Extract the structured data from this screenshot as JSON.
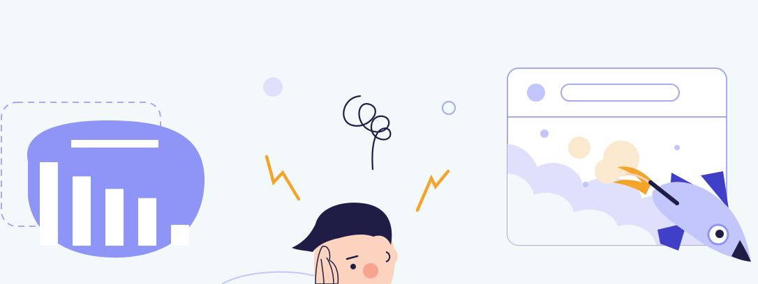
{
  "scene": {
    "background": "#f3f8fb",
    "accent": "#8f94f7",
    "light_accent": "#c3c6fb",
    "lavender": "#dfe0fb",
    "dark": "#1f1d45",
    "orange": "#f3a52b",
    "skin": "#fbd3bf",
    "cheek": "#f7a38e",
    "white": "#ffffff"
  },
  "bar_chart": {
    "bars": [
      1.0,
      0.83,
      0.68,
      0.57,
      0.25
    ]
  },
  "icons": {
    "chart": "bar-chart-icon",
    "browser": "browser-window-icon",
    "rocket": "rocket-icon",
    "person": "stressed-person-icon",
    "spiral": "dizzy-spiral-icon",
    "lightning": "lightning-icon"
  }
}
